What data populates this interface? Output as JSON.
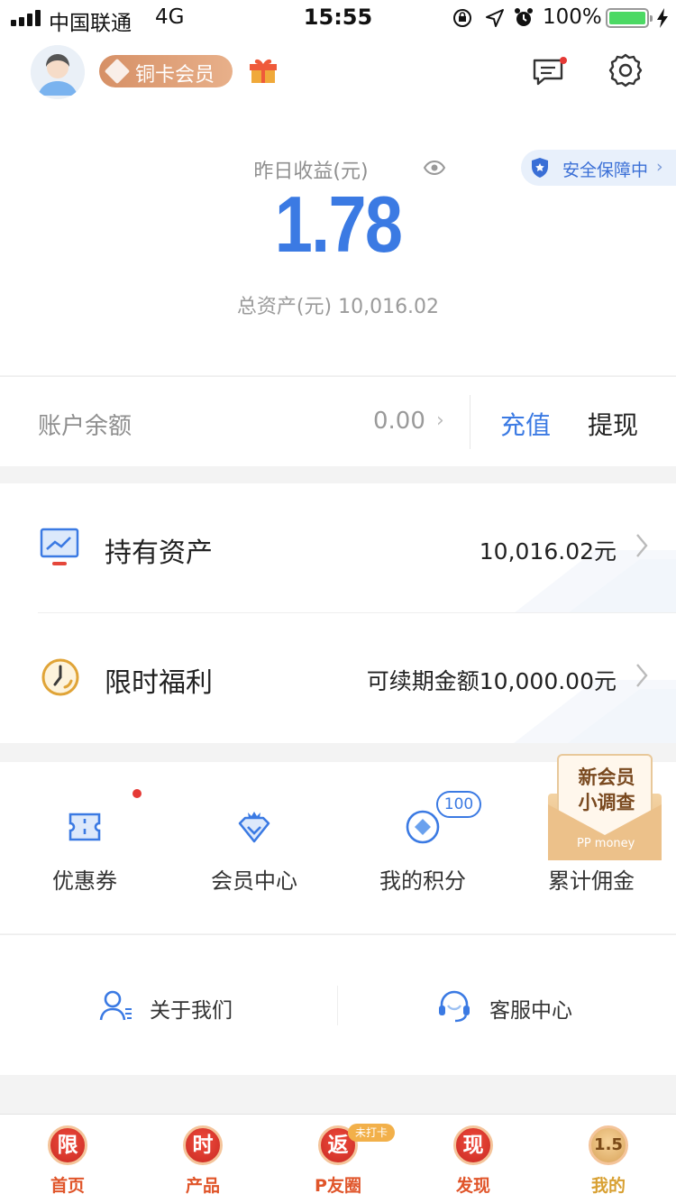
{
  "status_bar": {
    "carrier": "中国联通",
    "network": "4G",
    "time": "15:55",
    "battery": "100%"
  },
  "header": {
    "member_badge": "铜卡会员"
  },
  "earnings": {
    "yesterday_label": "昨日收益(元)",
    "yesterday_value": "1.78",
    "total_label": "总资产(元) 10,016.02",
    "safety": "安全保障中"
  },
  "balance": {
    "label": "账户余额",
    "value": "0.00",
    "recharge": "充值",
    "withdraw": "提现"
  },
  "assets": [
    {
      "label": "持有资产",
      "value": "10,016.02元"
    },
    {
      "label": "限时福利",
      "value": "可续期金额10,000.00元"
    }
  ],
  "shortcuts": [
    {
      "label": "优惠券"
    },
    {
      "label": "会员中心"
    },
    {
      "label": "我的积分",
      "badge": "100"
    },
    {
      "label": "累计佣金"
    }
  ],
  "survey": {
    "line1": "新会员",
    "line2": "小调查",
    "logo": "PP money"
  },
  "links": {
    "about": "关于我们",
    "service": "客服中心"
  },
  "tabs": [
    {
      "icon_char": "限",
      "label": "首页"
    },
    {
      "icon_char": "时",
      "label": "产品"
    },
    {
      "icon_char": "返",
      "label": "P友圈",
      "tag": "未打卡"
    },
    {
      "icon_char": "现",
      "label": "发现"
    },
    {
      "icon_char": "1.5",
      "label": "我的",
      "active": true
    }
  ],
  "colors": {
    "primary_blue": "#3b7ae3",
    "tab_red": "#e0552a",
    "tab_active": "#d8a032"
  }
}
